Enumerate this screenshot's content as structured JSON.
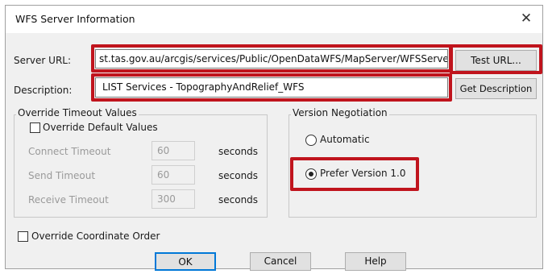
{
  "dialog": {
    "title": "WFS Server Information",
    "close_glyph": "✕"
  },
  "server_url": {
    "label": "Server URL:",
    "value": "st.tas.gov.au/arcgis/services/Public/OpenDataWFS/MapServer/WFSServer",
    "button": "Test URL..."
  },
  "description": {
    "label": "Description:",
    "value": "LIST Services - TopographyAndRelief_WFS",
    "button": "Get Description"
  },
  "timeout_group": {
    "title": "Override Timeout Values",
    "override_label": "Override Default Values",
    "override_checked": false,
    "rows": [
      {
        "label": "Connect Timeout",
        "value": "60",
        "unit": "seconds"
      },
      {
        "label": "Send Timeout",
        "value": "60",
        "unit": "seconds"
      },
      {
        "label": "Receive Timeout",
        "value": "300",
        "unit": "seconds"
      }
    ]
  },
  "version_group": {
    "title": "Version Negotiation",
    "options": [
      {
        "label": "Automatic",
        "selected": false
      },
      {
        "label": "Prefer Version 1.0",
        "selected": true
      }
    ]
  },
  "coord_order": {
    "label": "Override Coordinate Order",
    "checked": false
  },
  "footer": {
    "ok": "OK",
    "cancel": "Cancel",
    "help": "Help"
  },
  "colors": {
    "highlight": "#c0141d",
    "dialog_bg": "#f0f0f0",
    "disabled_text": "#9a9a9a"
  }
}
